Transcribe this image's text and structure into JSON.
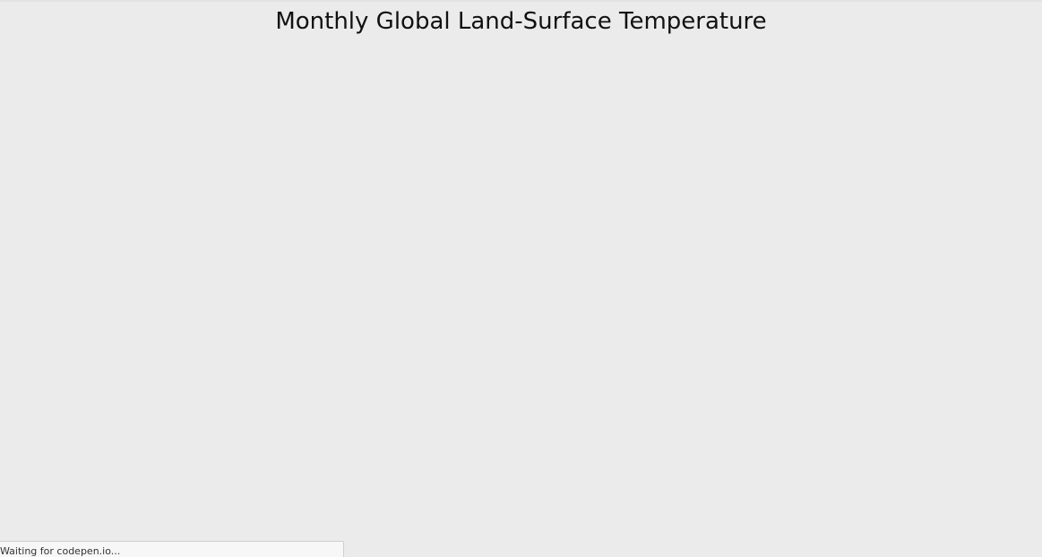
{
  "page": {
    "title": "Monthly Global Land-Surface Temperature",
    "background_color": "#ebebeb"
  },
  "status_bar": {
    "text": "Waiting for codepen.io..."
  }
}
